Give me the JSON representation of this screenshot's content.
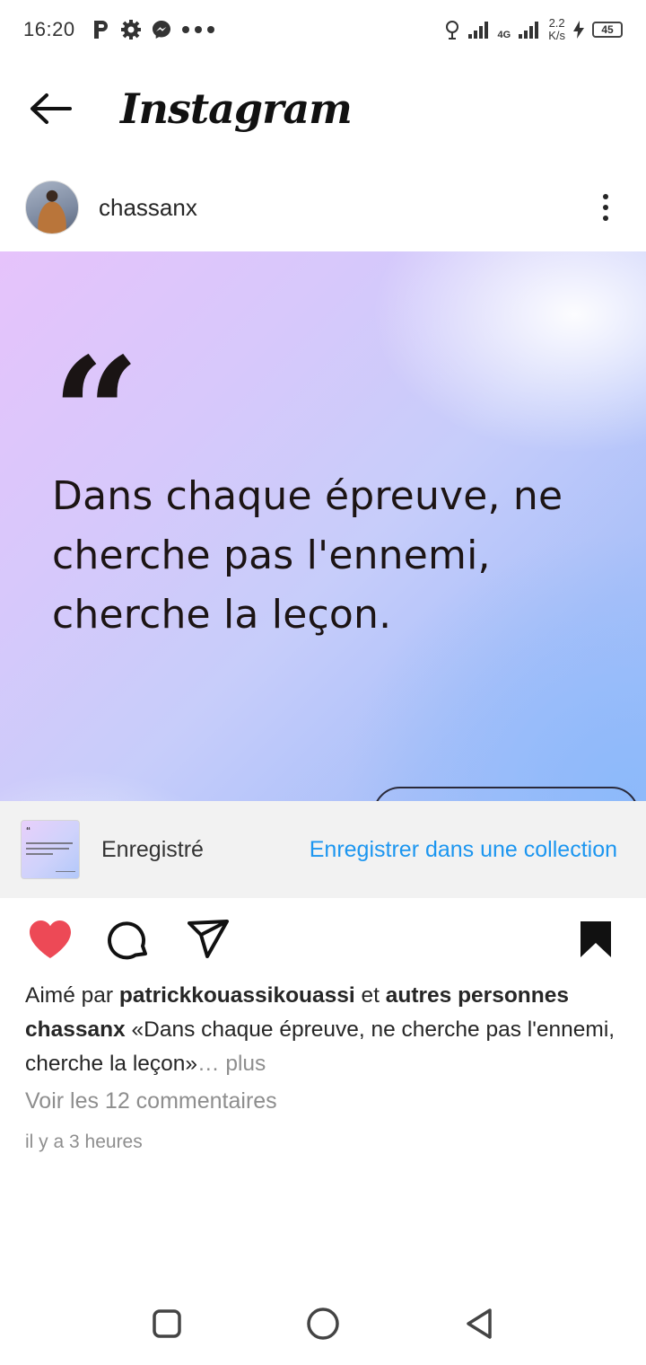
{
  "status_bar": {
    "time": "16:20",
    "network_type": "4G",
    "speed_value": "2.2",
    "speed_unit": "K/s",
    "battery": "45",
    "left_icons": [
      "p-icon",
      "gear-icon",
      "messenger-icon",
      "more-dots-icon"
    ],
    "right_icons": [
      "alarm-icon",
      "signal-icon",
      "signal-4g-icon",
      "charging-icon",
      "battery-icon"
    ]
  },
  "app_header": {
    "title": "Instagram",
    "back_icon": "arrow-left-icon"
  },
  "post": {
    "username": "chassanx",
    "image": {
      "quote_mark": "“",
      "quote_text": "Dans chaque épreuve, ne cherche pas l'ennemi, cherche la leçon.",
      "colors": {
        "gradient_start": "#e6c3fb",
        "gradient_end": "#9dbdf8",
        "text": "#1c1414"
      }
    },
    "saved_bar": {
      "status_label": "Enregistré",
      "collection_link": "Enregistrer dans une collection",
      "link_color": "#1c96f0"
    },
    "actions": {
      "like_icon": "heart-filled-icon",
      "comment_icon": "comment-icon",
      "share_icon": "send-icon",
      "save_icon": "bookmark-filled-icon",
      "like_color": "#ed4956"
    },
    "likes": {
      "prefix": "Aimé par",
      "user": "patrickkouassikouassi",
      "joiner": "et",
      "others": "autres personnes"
    },
    "caption": {
      "username": "chassanx",
      "text": "«Dans chaque épreuve, ne cherche pas l'ennemi, cherche la leçon»",
      "more": "… plus"
    },
    "comments_link": "Voir les 12 commentaires",
    "time_ago": "il y a 3 heures"
  },
  "nav_bar": {
    "buttons": [
      "recent-apps-icon",
      "home-icon",
      "back-triangle-icon"
    ]
  }
}
